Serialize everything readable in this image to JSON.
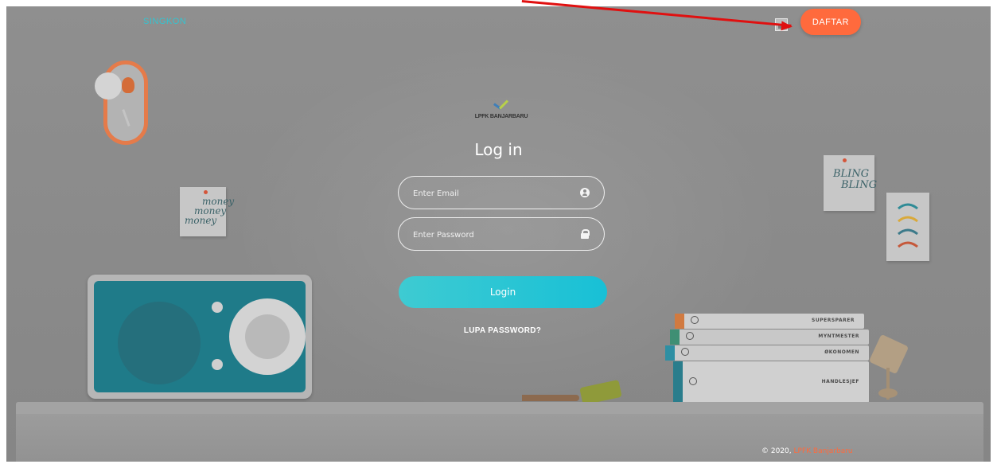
{
  "header": {
    "brand": "SINGKON",
    "register_label": "DAFTAR"
  },
  "decor": {
    "note_money": [
      "money",
      "money",
      "money"
    ],
    "note_bling": [
      "BLING",
      "BLING"
    ],
    "books": [
      "SUPERSPARER",
      "MYNTMESTER",
      "ØKONOMEN",
      "HANDLESJEF"
    ]
  },
  "login": {
    "logo_text": "LPFK BANJARBARU",
    "title": "Log in",
    "email_placeholder": "Enter Email",
    "password_placeholder": "Enter Password",
    "submit_label": "Login",
    "forgot_label": "LUPA PASSWORD?"
  },
  "footer": {
    "copyright": "© 2020,",
    "brand": "LPFK Banjarbaru"
  },
  "colors": {
    "accent": "#ff6a3d",
    "teal": "#18c0d6",
    "annotation_arrow": "#e01010"
  }
}
